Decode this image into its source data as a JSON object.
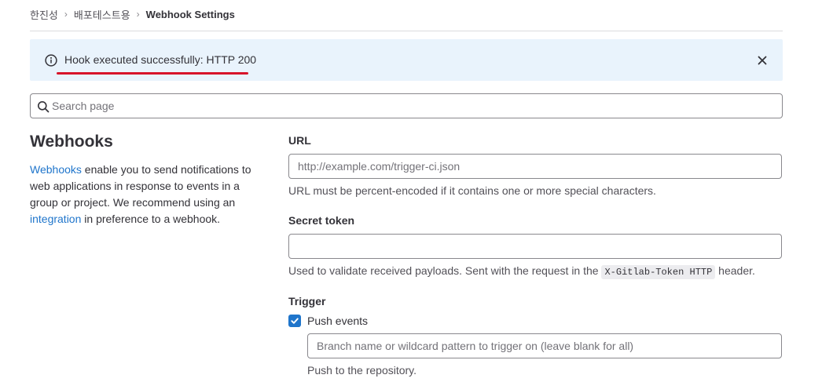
{
  "breadcrumb": {
    "items": [
      "한진성",
      "배포테스트용",
      "Webhook Settings"
    ],
    "separator": "›"
  },
  "alert": {
    "icon": "info-circle-icon",
    "message": "Hook executed successfully: HTTP 200",
    "close_icon": "close-icon",
    "background": "#e9f3fc"
  },
  "search": {
    "icon": "search-icon",
    "placeholder": "Search page",
    "value": ""
  },
  "section": {
    "title": "Webhooks",
    "desc_link1": "Webhooks",
    "desc_part1": " enable you to send notifications to web applications in response to events in a group or project. We recommend using an ",
    "desc_link2": "integration",
    "desc_part2": " in preference to a webhook."
  },
  "form": {
    "url": {
      "label": "URL",
      "placeholder": "http://example.com/trigger-ci.json",
      "value": "",
      "help": "URL must be percent-encoded if it contains one or more special characters."
    },
    "secret_token": {
      "label": "Secret token",
      "value": "",
      "help_before": "Used to validate received payloads. Sent with the request in the ",
      "help_code": "X-Gitlab-Token HTTP",
      "help_after": " header."
    },
    "trigger": {
      "label": "Trigger",
      "push_events": {
        "label": "Push events",
        "checked": true,
        "branch_placeholder": "Branch name or wildcard pattern to trigger on (leave blank for all)",
        "branch_value": "",
        "help": "Push to the repository."
      }
    }
  },
  "colors": {
    "link": "#1f75cb",
    "annotation": "#d7142a",
    "checkbox": "#1f75cb"
  }
}
